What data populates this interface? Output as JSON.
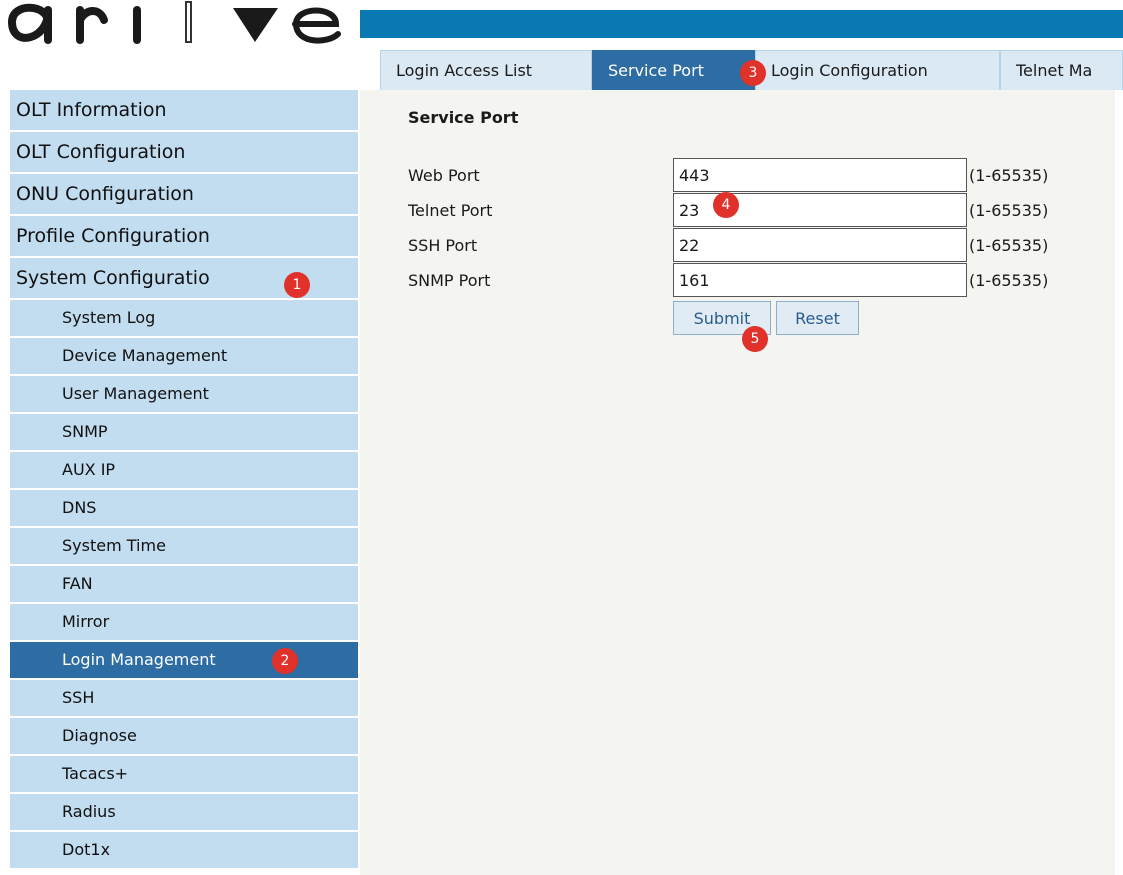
{
  "header": {
    "accent_color": "#0a78b2",
    "logo_icon": "brand-logo"
  },
  "tabs": [
    {
      "label": "Login Access List",
      "active": false
    },
    {
      "label": "Service Port",
      "active": true
    },
    {
      "label": "Login Configuration",
      "active": false
    },
    {
      "label": "Telnet Ma",
      "active": false
    }
  ],
  "sidebar": {
    "items": [
      {
        "label": "OLT Information"
      },
      {
        "label": "OLT Configuration"
      },
      {
        "label": "ONU Configuration"
      },
      {
        "label": "Profile Configuration"
      },
      {
        "label": "System Configuratio"
      }
    ],
    "sub_items": [
      {
        "label": "System Log"
      },
      {
        "label": "Device Management"
      },
      {
        "label": "User Management"
      },
      {
        "label": "SNMP"
      },
      {
        "label": "AUX IP"
      },
      {
        "label": "DNS"
      },
      {
        "label": "System Time"
      },
      {
        "label": "FAN"
      },
      {
        "label": "Mirror"
      },
      {
        "label": "Login Management",
        "active": true
      },
      {
        "label": "SSH"
      },
      {
        "label": "Diagnose"
      },
      {
        "label": "Tacacs+"
      },
      {
        "label": "Radius"
      },
      {
        "label": "Dot1x"
      }
    ]
  },
  "panel": {
    "title": "Service Port",
    "fields": [
      {
        "label": "Web Port",
        "value": "443",
        "range": "(1-65535)"
      },
      {
        "label": "Telnet Port",
        "value": "23",
        "range": "(1-65535)"
      },
      {
        "label": "SSH Port",
        "value": "22",
        "range": "(1-65535)"
      },
      {
        "label": "SNMP Port",
        "value": "161",
        "range": "(1-65535)"
      }
    ],
    "submit_label": "Submit",
    "reset_label": "Reset"
  },
  "markers": [
    "1",
    "2",
    "3",
    "4",
    "5"
  ],
  "colors": {
    "active_bg": "#2d6da4",
    "nav_bg": "#c2dcf0",
    "marker": "#e0312a",
    "content_bg": "#f4f5f1"
  }
}
